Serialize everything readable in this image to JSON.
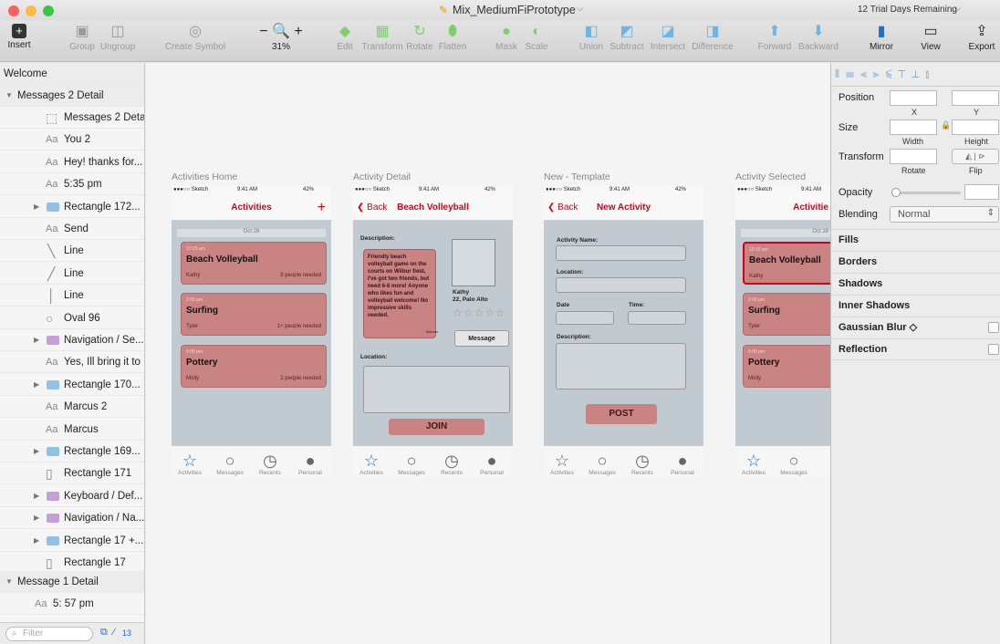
{
  "window": {
    "title": "Mix_MediumFiPrototype",
    "trial": "12 Trial Days Remaining"
  },
  "toolbar": {
    "insert": "Insert",
    "group": "Group",
    "ungroup": "Ungroup",
    "create_symbol": "Create Symbol",
    "zoom": "31%",
    "edit": "Edit",
    "transform": "Transform",
    "rotate": "Rotate",
    "flatten": "Flatten",
    "mask": "Mask",
    "scale": "Scale",
    "union": "Union",
    "subtract": "Subtract",
    "intersect": "Intersect",
    "difference": "Difference",
    "forward": "Forward",
    "backward": "Backward",
    "mirror": "Mirror",
    "view": "View",
    "export": "Export"
  },
  "sidebar": {
    "page": "Welcome",
    "groups": [
      {
        "label": "Messages 2 Detail"
      },
      {
        "label": "Message 1 Detail"
      }
    ],
    "layers": [
      {
        "kind": "artboard",
        "label": "Messages 2 Detail"
      },
      {
        "kind": "Aa",
        "label": "You 2"
      },
      {
        "kind": "Aa",
        "label": "Hey! thanks for..."
      },
      {
        "kind": "Aa",
        "label": "5:35 pm"
      },
      {
        "kind": "folder",
        "label": "Rectangle 172..."
      },
      {
        "kind": "Aa",
        "label": "Send"
      },
      {
        "kind": "line",
        "label": "Line"
      },
      {
        "kind": "line",
        "label": "Line"
      },
      {
        "kind": "line",
        "label": "Line"
      },
      {
        "kind": "oval",
        "label": "Oval 96"
      },
      {
        "kind": "folder",
        "label": "Navigation / Se..."
      },
      {
        "kind": "Aa",
        "label": "Yes, Ill bring it to"
      },
      {
        "kind": "folder",
        "label": "Rectangle 170..."
      },
      {
        "kind": "Aa",
        "label": "Marcus 2"
      },
      {
        "kind": "Aa",
        "label": "Marcus"
      },
      {
        "kind": "folder",
        "label": "Rectangle 169..."
      },
      {
        "kind": "rect",
        "label": "Rectangle 171"
      },
      {
        "kind": "folder",
        "label": "Keyboard / Def..."
      },
      {
        "kind": "folder",
        "label": "Navigation / Na..."
      },
      {
        "kind": "folder",
        "label": "Rectangle 17 +..."
      },
      {
        "kind": "rect",
        "label": "Rectangle 17"
      }
    ],
    "sub_layer": {
      "kind": "Aa",
      "label": "5: 57 pm"
    },
    "filter_placeholder": "Filter",
    "count": "13"
  },
  "artboards": {
    "status": {
      "carrier": "●●●○○ Sketch",
      "time": "9:41 AM",
      "battery": "42%"
    },
    "tabs": [
      "Activities",
      "Messages",
      "Recents",
      "Personal"
    ],
    "home": {
      "label": "Activities Home",
      "title": "Activities",
      "plus": "+",
      "date": "Oct 28",
      "cards": [
        {
          "time": "10:15 am",
          "title": "Beach Volleyball",
          "name": "Kathy",
          "people": "8 people needed"
        },
        {
          "time": "2:00 pm",
          "title": "Surfing",
          "name": "Tyler",
          "people": "1+ people needed"
        },
        {
          "time": "6:00 pm",
          "title": "Pottery",
          "name": "Molly",
          "people": "2 people needed"
        }
      ]
    },
    "detail": {
      "label": "Activity Detail",
      "back": "Back",
      "title": "Beach Volleyball",
      "desc_label": "Description:",
      "desc": "Friendly beach volleyball game on the courts on Wilbur field, I've got two friends, but need 6-8 more! Anyone who likes fun and volleyball welcome! No impressive skills needed.",
      "author_small": "Marcus",
      "person": "Kathy",
      "person_info": "22, Palo Alto",
      "stars": "☆☆☆☆☆",
      "message": "Message",
      "location_label": "Location:",
      "join": "JOIN"
    },
    "template": {
      "label": "New - Template",
      "back": "Back",
      "title": "New Activity",
      "name_label": "Activity Name:",
      "location_label": "Location:",
      "date_label": "Date",
      "time_label": "Time:",
      "desc_label": "Description:",
      "post": "POST"
    },
    "selected": {
      "label": "Activity Selected",
      "title": "Activitie",
      "date": "Oct 28",
      "cards": [
        {
          "time": "10:15 am",
          "title": "Beach Volleyball",
          "name": "Kathy"
        },
        {
          "time": "2:00 pm",
          "title": "Surfing",
          "name": "Tyler"
        },
        {
          "time": "6:00 pm",
          "title": "Pottery",
          "name": "Molly"
        }
      ]
    }
  },
  "inspector": {
    "position": "Position",
    "x": "X",
    "y": "Y",
    "size": "Size",
    "width": "Width",
    "height": "Height",
    "transform": "Transform",
    "rotate": "Rotate",
    "flip": "Flip",
    "opacity": "Opacity",
    "blending": "Blending",
    "blend_value": "Normal",
    "sections": [
      "Fills",
      "Borders",
      "Shadows",
      "Inner Shadows",
      "Gaussian Blur ◇",
      "Reflection"
    ]
  },
  "colors": {
    "accent": "#d0021b",
    "card": "#c98383",
    "artboard_bg": "#c2cad1",
    "folder": "#8fc2e6",
    "folder_symbol": "#c79fd8"
  }
}
